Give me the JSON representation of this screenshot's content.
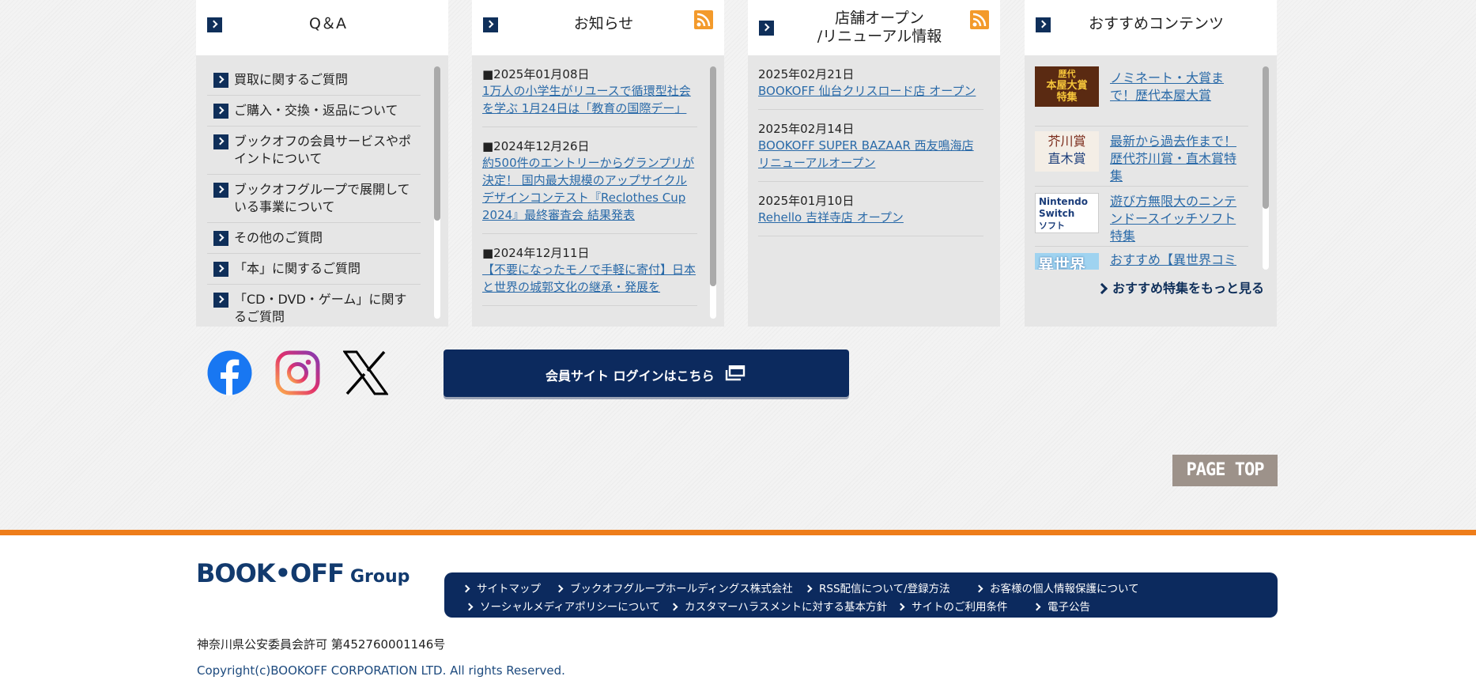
{
  "qa": {
    "title": "Q＆A",
    "items": [
      "買取に関するご質問",
      "ご購入・交換・返品について",
      "ブックオフの会員サービスやポイントについて",
      "ブックオフグループで展開している事業について",
      "その他のご質問",
      "「本」に関するご質問",
      "「CD・DVD・ゲーム」に関するご質問"
    ]
  },
  "news": {
    "title": "お知らせ",
    "items": [
      {
        "date": "■2025年01月08日",
        "text": "1万人の小学生がリユースで循環型社会を学ぶ 1月24日は「教育の国際デー」"
      },
      {
        "date": "■2024年12月26日",
        "text": "約500件のエントリーからグランプリが決定！ 国内最大規模のアップサイクルデザインコンテスト『Reclothes Cup 2024』最終審査会 結果発表"
      },
      {
        "date": "■2024年12月11日",
        "text": "【不要になったモノで手軽に寄付】日本と世界の城郭文化の継承・発展を"
      }
    ]
  },
  "stores": {
    "title_line1": "店舗オープン",
    "title_line2": "/リニューアル情報",
    "items": [
      {
        "date": "2025年02月21日",
        "text": "BOOKOFF 仙台クリスロード店 オープン"
      },
      {
        "date": "2025年02月14日",
        "text": "BOOKOFF SUPER BAZAAR 西友鳴海店 リニューアルオープン"
      },
      {
        "date": "2025年01月10日",
        "text": "Rehello 吉祥寺店 オープン"
      }
    ]
  },
  "recommend": {
    "title": "おすすめコンテンツ",
    "items": [
      {
        "thumb_line1": "歴代",
        "thumb_line2": "本屋大賞",
        "thumb_line3": "特集",
        "text": "ノミネート・大賞まで！歴代本屋大賞"
      },
      {
        "thumb_line1": "芥川賞",
        "thumb_line2": "直木賞",
        "text": "最新から過去作まで！歴代芥川賞・直木賞特集"
      },
      {
        "thumb_line1": "Nintendo",
        "thumb_line2": "Switch",
        "thumb_line3": "ソフト",
        "text": "遊び方無限大のニンテンドースイッチソフト特集"
      },
      {
        "thumb_line1": "異世界",
        "text": "おすすめ【異世界コミック特集】転生・召喚漫画一"
      }
    ],
    "more": "おすすめ特集をもっと見る"
  },
  "login": {
    "label": "会員サイト ログインはこちら"
  },
  "page_top": "PAGE TOP",
  "footer": {
    "logo": "BOOK•OFF",
    "logo_group": "Group",
    "links_row1": [
      "サイトマップ",
      "ブックオフグループホールディングス株式会社",
      "RSS配信について/登録方法",
      "お客様の個人情報保護について"
    ],
    "links_row2": [
      "ソーシャルメディアポリシーについて",
      "カスタマーハラスメントに対する基本方針",
      "サイトのご利用条件",
      "電子公告"
    ],
    "license": "神奈川県公安委員会許可 第452760001146号",
    "copyright": "Copyright(c)BOOKOFF CORPORATION LTD. All rights Reserved."
  },
  "colors": {
    "navy": "#0c2a5e",
    "orange": "#ee7d1a",
    "link": "#2a6aa8"
  }
}
